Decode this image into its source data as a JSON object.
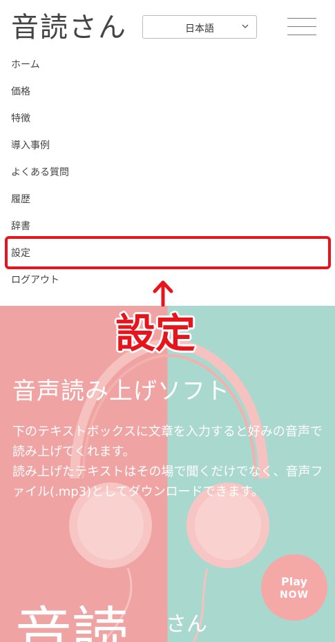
{
  "header": {
    "logo": "音読さん",
    "language": {
      "selected": "日本語"
    }
  },
  "menu": {
    "items": [
      {
        "label": "ホーム"
      },
      {
        "label": "価格"
      },
      {
        "label": "特徴"
      },
      {
        "label": "導入事例"
      },
      {
        "label": "よくある質問"
      },
      {
        "label": "履歴"
      },
      {
        "label": "辞書"
      },
      {
        "label": "設定"
      },
      {
        "label": "ログアウト"
      }
    ]
  },
  "annotation": {
    "label": "設定",
    "color": "#e8141c"
  },
  "hero": {
    "title": "音声読み上げソフト",
    "description_line1": "下のテキストボックスに文章を入力すると好みの音声で読み上げてくれます。",
    "description_line2": "読み上げたテキストはその場で聞くだけでなく、音声ファイル(.mp3)としてダウンロードできます。",
    "play_label": "Play",
    "play_sub": "NOW",
    "big_logo": "音読",
    "big_logo_partial": "さん",
    "colors": {
      "left": "#f0a3a3",
      "right": "#a9d8cf",
      "play_button": "#f5a9a6"
    }
  }
}
